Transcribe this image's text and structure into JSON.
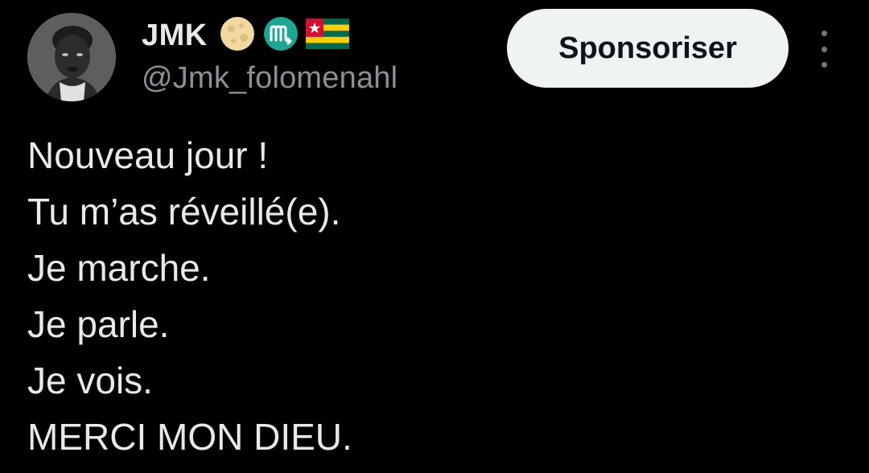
{
  "author": {
    "display_name": "JMK",
    "handle": "@Jmk_folomenahl",
    "name_emojis": [
      "full-moon-emoji",
      "scorpio-sign-emoji",
      "togo-flag-emoji"
    ]
  },
  "actions": {
    "sponsor_label": "Sponsoriser",
    "more_icon": "vertical-ellipsis-icon"
  },
  "tweet": {
    "lines": [
      "Nouveau jour !",
      "Tu m’as réveillé(e).",
      "Je marche.",
      "Je parle.",
      "Je vois.",
      "MERCI MON DIEU."
    ]
  },
  "colors": {
    "background": "#000000",
    "text_primary": "#e7e9ea",
    "text_secondary": "#8b9096",
    "button_bg": "#eff3f4",
    "button_text": "#0f1419",
    "scorpio_badge": "#1fa593",
    "togo_green": "#006a4e",
    "togo_yellow": "#ffce00",
    "togo_red": "#d21034"
  }
}
